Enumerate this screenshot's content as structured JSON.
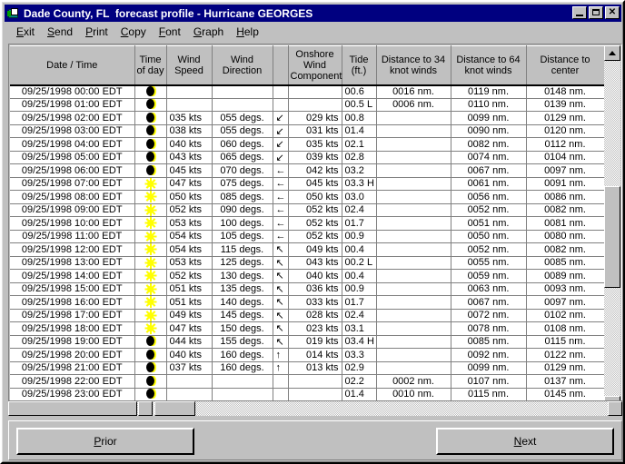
{
  "window": {
    "title": "Dade County, FL  forecast profile - Hurricane GEORGES",
    "icon": "book-icon",
    "minimize_label": "_",
    "maximize_label": "□",
    "close_label": "✕"
  },
  "menu": {
    "items": [
      {
        "label": "Exit",
        "accel": "E"
      },
      {
        "label": "Send",
        "accel": "S"
      },
      {
        "label": "Print",
        "accel": "P"
      },
      {
        "label": "Copy",
        "accel": "C"
      },
      {
        "label": "Font",
        "accel": "F"
      },
      {
        "label": "Graph",
        "accel": "G"
      },
      {
        "label": "Help",
        "accel": "H"
      }
    ]
  },
  "grid": {
    "columns": [
      {
        "key": "date",
        "header": "Date / Time"
      },
      {
        "key": "tod",
        "header": "Time\nof day"
      },
      {
        "key": "speed",
        "header": "Wind\nSpeed"
      },
      {
        "key": "dir",
        "header": "Wind\nDirection"
      },
      {
        "key": "arrow",
        "header": ""
      },
      {
        "key": "osw",
        "header": "Onshore\nWind\nComponent"
      },
      {
        "key": "tide",
        "header": "Tide\n(ft.)"
      },
      {
        "key": "d34",
        "header": "Distance to 34\nknot winds"
      },
      {
        "key": "d64",
        "header": "Distance to 64\nknot winds"
      },
      {
        "key": "dc",
        "header": "Distance to\ncenter"
      }
    ],
    "rows": [
      {
        "date": "09/25/1998 00:00 EDT",
        "tod": "moon",
        "speed": "",
        "dir": "",
        "arrow": "",
        "osw": "",
        "tide": "00.6",
        "d34": "0016 nm.",
        "d64": "0119 nm.",
        "dc": "0148 nm."
      },
      {
        "date": "09/25/1998 01:00 EDT",
        "tod": "moon",
        "speed": "",
        "dir": "",
        "arrow": "",
        "osw": "",
        "tide": "00.5 L",
        "d34": "0006 nm.",
        "d64": "0110 nm.",
        "dc": "0139 nm."
      },
      {
        "date": "09/25/1998 02:00 EDT",
        "tod": "moon",
        "speed": "035 kts",
        "dir": "055 degs.",
        "arrow": "↙",
        "osw": "029 kts",
        "tide": "00.8",
        "d34": "",
        "d64": "0099 nm.",
        "dc": "0129 nm."
      },
      {
        "date": "09/25/1998 03:00 EDT",
        "tod": "moon",
        "speed": "038 kts",
        "dir": "055 degs.",
        "arrow": "↙",
        "osw": "031 kts",
        "tide": "01.4",
        "d34": "",
        "d64": "0090 nm.",
        "dc": "0120 nm."
      },
      {
        "date": "09/25/1998 04:00 EDT",
        "tod": "moon",
        "speed": "040 kts",
        "dir": "060 degs.",
        "arrow": "↙",
        "osw": "035 kts",
        "tide": "02.1",
        "d34": "",
        "d64": "0082 nm.",
        "dc": "0112 nm."
      },
      {
        "date": "09/25/1998 05:00 EDT",
        "tod": "moon",
        "speed": "043 kts",
        "dir": "065 degs.",
        "arrow": "↙",
        "osw": "039 kts",
        "tide": "02.8",
        "d34": "",
        "d64": "0074 nm.",
        "dc": "0104 nm."
      },
      {
        "date": "09/25/1998 06:00 EDT",
        "tod": "moon",
        "speed": "045 kts",
        "dir": "070 degs.",
        "arrow": "←",
        "osw": "042 kts",
        "tide": "03.2",
        "d34": "",
        "d64": "0067 nm.",
        "dc": "0097 nm."
      },
      {
        "date": "09/25/1998 07:00 EDT",
        "tod": "sun",
        "speed": "047 kts",
        "dir": "075 degs.",
        "arrow": "←",
        "osw": "045 kts",
        "tide": "03.3 H",
        "d34": "",
        "d64": "0061 nm.",
        "dc": "0091 nm."
      },
      {
        "date": "09/25/1998 08:00 EDT",
        "tod": "sun",
        "speed": "050 kts",
        "dir": "085 degs.",
        "arrow": "←",
        "osw": "050 kts",
        "tide": "03.0",
        "d34": "",
        "d64": "0056 nm.",
        "dc": "0086 nm."
      },
      {
        "date": "09/25/1998 09:00 EDT",
        "tod": "sun",
        "speed": "052 kts",
        "dir": "090 degs.",
        "arrow": "←",
        "osw": "052 kts",
        "tide": "02.4",
        "d34": "",
        "d64": "0052 nm.",
        "dc": "0082 nm."
      },
      {
        "date": "09/25/1998 10:00 EDT",
        "tod": "sun",
        "speed": "053 kts",
        "dir": "100 degs.",
        "arrow": "←",
        "osw": "052 kts",
        "tide": "01.7",
        "d34": "",
        "d64": "0051 nm.",
        "dc": "0081 nm."
      },
      {
        "date": "09/25/1998 11:00 EDT",
        "tod": "sun",
        "speed": "054 kts",
        "dir": "105 degs.",
        "arrow": "←",
        "osw": "052 kts",
        "tide": "00.9",
        "d34": "",
        "d64": "0050 nm.",
        "dc": "0080 nm."
      },
      {
        "date": "09/25/1998 12:00 EDT",
        "tod": "sun",
        "speed": "054 kts",
        "dir": "115 degs.",
        "arrow": "↖",
        "osw": "049 kts",
        "tide": "00.4",
        "d34": "",
        "d64": "0052 nm.",
        "dc": "0082 nm."
      },
      {
        "date": "09/25/1998 13:00 EDT",
        "tod": "sun",
        "speed": "053 kts",
        "dir": "125 degs.",
        "arrow": "↖",
        "osw": "043 kts",
        "tide": "00.2 L",
        "d34": "",
        "d64": "0055 nm.",
        "dc": "0085 nm."
      },
      {
        "date": "09/25/1998 14:00 EDT",
        "tod": "sun",
        "speed": "052 kts",
        "dir": "130 degs.",
        "arrow": "↖",
        "osw": "040 kts",
        "tide": "00.4",
        "d34": "",
        "d64": "0059 nm.",
        "dc": "0089 nm."
      },
      {
        "date": "09/25/1998 15:00 EDT",
        "tod": "sun",
        "speed": "051 kts",
        "dir": "135 degs.",
        "arrow": "↖",
        "osw": "036 kts",
        "tide": "00.9",
        "d34": "",
        "d64": "0063 nm.",
        "dc": "0093 nm."
      },
      {
        "date": "09/25/1998 16:00 EDT",
        "tod": "sun",
        "speed": "051 kts",
        "dir": "140 degs.",
        "arrow": "↖",
        "osw": "033 kts",
        "tide": "01.7",
        "d34": "",
        "d64": "0067 nm.",
        "dc": "0097 nm."
      },
      {
        "date": "09/25/1998 17:00 EDT",
        "tod": "sun",
        "speed": "049 kts",
        "dir": "145 degs.",
        "arrow": "↖",
        "osw": "028 kts",
        "tide": "02.4",
        "d34": "",
        "d64": "0072 nm.",
        "dc": "0102 nm."
      },
      {
        "date": "09/25/1998 18:00 EDT",
        "tod": "sun",
        "speed": "047 kts",
        "dir": "150 degs.",
        "arrow": "↖",
        "osw": "023 kts",
        "tide": "03.1",
        "d34": "",
        "d64": "0078 nm.",
        "dc": "0108 nm."
      },
      {
        "date": "09/25/1998 19:00 EDT",
        "tod": "moon",
        "speed": "044 kts",
        "dir": "155 degs.",
        "arrow": "↖",
        "osw": "019 kts",
        "tide": "03.4 H",
        "d34": "",
        "d64": "0085 nm.",
        "dc": "0115 nm."
      },
      {
        "date": "09/25/1998 20:00 EDT",
        "tod": "moon",
        "speed": "040 kts",
        "dir": "160 degs.",
        "arrow": "↑",
        "osw": "014 kts",
        "tide": "03.3",
        "d34": "",
        "d64": "0092 nm.",
        "dc": "0122 nm."
      },
      {
        "date": "09/25/1998 21:00 EDT",
        "tod": "moon",
        "speed": "037 kts",
        "dir": "160 degs.",
        "arrow": "↑",
        "osw": "013 kts",
        "tide": "02.9",
        "d34": "",
        "d64": "0099 nm.",
        "dc": "0129 nm."
      },
      {
        "date": "09/25/1998 22:00 EDT",
        "tod": "moon",
        "speed": "",
        "dir": "",
        "arrow": "",
        "osw": "",
        "tide": "02.2",
        "d34": "0002 nm.",
        "d64": "0107 nm.",
        "dc": "0137 nm."
      },
      {
        "date": "09/25/1998 23:00 EDT",
        "tod": "moon",
        "speed": "",
        "dir": "",
        "arrow": "",
        "osw": "",
        "tide": "01.4",
        "d34": "0010 nm.",
        "d64": "0115 nm.",
        "dc": "0145 nm."
      }
    ]
  },
  "scrollbars": {
    "v_up_label": "▲",
    "v_down_label": "▼",
    "h_left_label": "◄",
    "h_right_label": "►"
  },
  "footer": {
    "prior_label": "Prior",
    "prior_accel": "P",
    "next_label": "Next",
    "next_accel": "N"
  },
  "colors": {
    "titlebar": "#000080",
    "face": "#c0c0c0",
    "sun": "#ffff00",
    "moon_dark": "#000000"
  }
}
